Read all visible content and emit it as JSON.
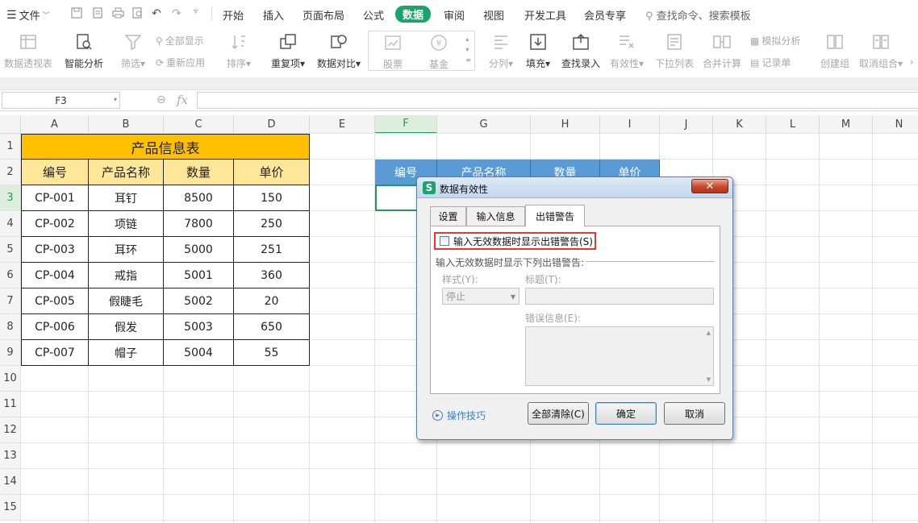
{
  "menu": {
    "file_label": "文件",
    "tabs": [
      "开始",
      "插入",
      "页面布局",
      "公式",
      "数据",
      "审阅",
      "视图",
      "开发工具",
      "会员专享"
    ],
    "active_tab": "数据",
    "search_placeholder": "查找命令、搜索模板"
  },
  "ribbon": {
    "pivot": "数据透视表",
    "smart_analysis": "智能分析",
    "filter": "筛选",
    "show_all": "全部显示",
    "reapply": "重新应用",
    "sort": "排序",
    "duplicates": "重复项",
    "compare": "数据对比",
    "stock": "股票",
    "fund": "基金",
    "split": "分列",
    "fill": "填充",
    "lookup_entry": "查找录入",
    "validity": "有效性",
    "dropdown_list": "下拉列表",
    "consolidate": "合并计算",
    "simulation": "模拟分析",
    "record_sheet": "记录单",
    "create_group": "创建组",
    "ungroup": "取消组合"
  },
  "formula_bar": {
    "name_box": "F3",
    "fx": "fx",
    "formula": ""
  },
  "grid": {
    "columns": [
      "A",
      "B",
      "C",
      "D",
      "E",
      "F",
      "G",
      "H",
      "I",
      "J",
      "K",
      "L",
      "M",
      "N"
    ],
    "selected_column": "F",
    "rows": [
      "1",
      "2",
      "3",
      "4",
      "5",
      "6",
      "7",
      "8",
      "9",
      "10",
      "11",
      "12",
      "13",
      "14",
      "15"
    ],
    "selected_row": "3"
  },
  "table": {
    "title": "产品信息表",
    "headers": [
      "编号",
      "产品名称",
      "数量",
      "单价"
    ],
    "rows": [
      [
        "CP-001",
        "耳钉",
        "8500",
        "150"
      ],
      [
        "CP-002",
        "项链",
        "7800",
        "250"
      ],
      [
        "CP-003",
        "耳环",
        "5000",
        "251"
      ],
      [
        "CP-004",
        "戒指",
        "5001",
        "360"
      ],
      [
        "CP-005",
        "假睫毛",
        "5002",
        "20"
      ],
      [
        "CP-006",
        "假发",
        "5003",
        "650"
      ],
      [
        "CP-007",
        "帽子",
        "5004",
        "55"
      ]
    ]
  },
  "lookup_headers": [
    "编号",
    "产品名称",
    "数量",
    "单价"
  ],
  "dialog": {
    "logo": "S",
    "title": "数据有效性",
    "close": "✕",
    "tabs": [
      "设置",
      "输入信息",
      "出错警告"
    ],
    "active_tab": "出错警告",
    "checkbox_label": "输入无效数据时显示出错警告(S)",
    "group_title": "输入无效数据时显示下列出错警告:",
    "style_label": "样式(Y):",
    "style_value": "停止",
    "title_label": "标题(T):",
    "error_label": "错误信息(E):",
    "tips": "操作技巧",
    "btn_clear": "全部清除(C)",
    "btn_ok": "确定",
    "btn_cancel": "取消"
  }
}
